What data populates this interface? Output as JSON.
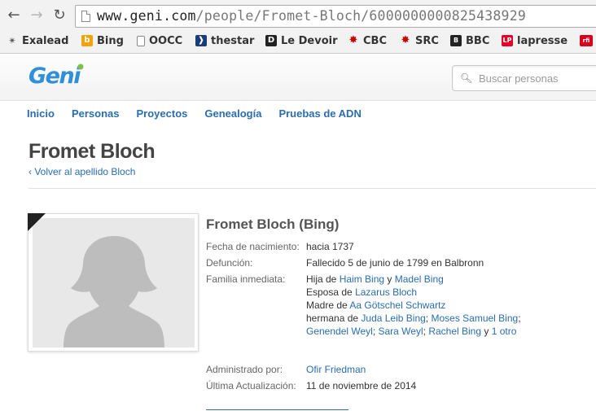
{
  "browser": {
    "url_host": "www.geni.com",
    "url_path": "/people/Fromet-Bloch/6000000000825438929",
    "bookmarks": [
      {
        "label": "Exalead",
        "icon": "exalead-icon",
        "color": "#555555",
        "glyph": "✴"
      },
      {
        "label": "Bing",
        "icon": "bing-icon",
        "color": "#f0a30a",
        "glyph": "b"
      },
      {
        "label": "OOCC",
        "icon": "page-icon",
        "color": "#ffffff",
        "glyph": ""
      },
      {
        "label": "thestar",
        "icon": "thestar-icon",
        "color": "#1a3c7a",
        "glyph": "❱"
      },
      {
        "label": "Le Devoir",
        "icon": "ledevoir-icon",
        "color": "#222222",
        "glyph": "D"
      },
      {
        "label": "CBC",
        "icon": "cbc-icon",
        "color": "#cc0000",
        "glyph": "✸"
      },
      {
        "label": "SRC",
        "icon": "src-icon",
        "color": "#cc0000",
        "glyph": "✸"
      },
      {
        "label": "BBC",
        "icon": "bbc-icon",
        "color": "#222222",
        "glyph": "B"
      },
      {
        "label": "lapresse",
        "icon": "lapresse-icon",
        "color": "#e4002b",
        "glyph": "LP"
      },
      {
        "label": "",
        "icon": "rfi-icon",
        "color": "#d6001c",
        "glyph": "rfi"
      }
    ]
  },
  "site": {
    "logo_text": "Geni",
    "search_placeholder": "Buscar personas",
    "accent": "#2a6db0"
  },
  "nav": {
    "items": [
      "Inicio",
      "Personas",
      "Proyectos",
      "Genealogía",
      "Pruebas de ADN"
    ]
  },
  "page": {
    "title": "Fromet Bloch",
    "back_link": "‹ Volver al apellido Bloch"
  },
  "profile": {
    "name": "Fromet Bloch (Bing)",
    "birth_label": "Fecha de nacimiento:",
    "birth_value": "hacia 1737",
    "death_label": "Defunción:",
    "death_value": "Fallecido 5 de junio de 1799 en Balbronn",
    "family_label": "Familia inmediata:",
    "family": {
      "daughter_of": "Hija de",
      "father": "Haim Bing",
      "and": "y",
      "mother": "Madel Bing",
      "wife_of": "Esposa de",
      "husband": "Lazarus Bloch",
      "mother_of": "Madre de",
      "child": "Aa Götschel Schwartz",
      "sister_of": "hermana de",
      "siblings": [
        "Juda Leib Bing",
        "Moses Samuel Bing",
        "Genendel Weyl",
        "Sara Weyl",
        "Rachel Bing"
      ],
      "more": "1 otro"
    },
    "managed_label": "Administrado por:",
    "managed_value": "Ofir Friedman",
    "updated_label": "Última Actualización:",
    "updated_value": "11 de noviembre de 2014"
  }
}
